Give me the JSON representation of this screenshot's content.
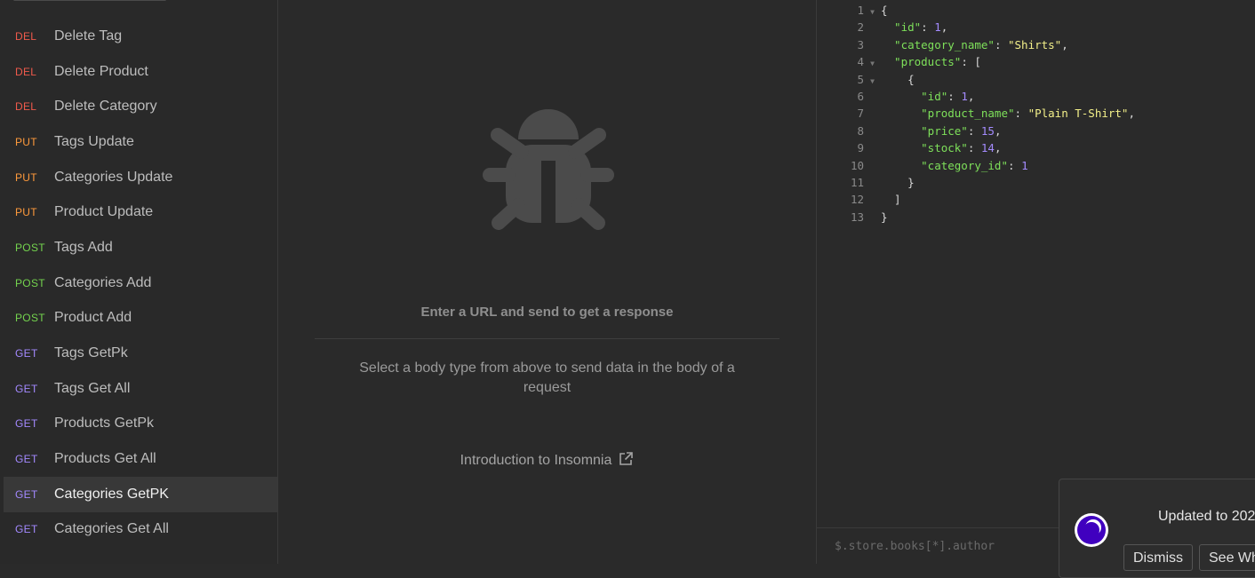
{
  "sidebar": {
    "items": [
      {
        "method": "DEL",
        "label": "Delete Tag"
      },
      {
        "method": "DEL",
        "label": "Delete Product"
      },
      {
        "method": "DEL",
        "label": "Delete Category"
      },
      {
        "method": "PUT",
        "label": "Tags Update"
      },
      {
        "method": "PUT",
        "label": "Categories Update"
      },
      {
        "method": "PUT",
        "label": "Product Update"
      },
      {
        "method": "POST",
        "label": "Tags Add"
      },
      {
        "method": "POST",
        "label": "Categories Add"
      },
      {
        "method": "POST",
        "label": "Product Add"
      },
      {
        "method": "GET",
        "label": "Tags GetPk"
      },
      {
        "method": "GET",
        "label": "Tags Get All"
      },
      {
        "method": "GET",
        "label": "Products GetPk"
      },
      {
        "method": "GET",
        "label": "Products Get All"
      },
      {
        "method": "GET",
        "label": "Categories GetPK",
        "active": true
      },
      {
        "method": "GET",
        "label": "Categories Get All"
      }
    ]
  },
  "request": {
    "empty_title": "Enter a URL and send to get a response",
    "empty_hint": "Select a body type from above to send data in the body of a request",
    "intro_link": "Introduction to Insomnia"
  },
  "response": {
    "lines": [
      [
        [
          "punc",
          "{"
        ]
      ],
      [
        [
          "key",
          "  \"id\""
        ],
        [
          "punc",
          ": "
        ],
        [
          "num",
          "1"
        ],
        [
          "punc",
          ","
        ]
      ],
      [
        [
          "key",
          "  \"category_name\""
        ],
        [
          "punc",
          ": "
        ],
        [
          "str",
          "\"Shirts\""
        ],
        [
          "punc",
          ","
        ]
      ],
      [
        [
          "key",
          "  \"products\""
        ],
        [
          "punc",
          ": ["
        ]
      ],
      [
        [
          "punc",
          "    {"
        ]
      ],
      [
        [
          "key",
          "      \"id\""
        ],
        [
          "punc",
          ": "
        ],
        [
          "num",
          "1"
        ],
        [
          "punc",
          ","
        ]
      ],
      [
        [
          "key",
          "      \"product_name\""
        ],
        [
          "punc",
          ": "
        ],
        [
          "str",
          "\"Plain T-Shirt\""
        ],
        [
          "punc",
          ","
        ]
      ],
      [
        [
          "key",
          "      \"price\""
        ],
        [
          "punc",
          ": "
        ],
        [
          "num",
          "15"
        ],
        [
          "punc",
          ","
        ]
      ],
      [
        [
          "key",
          "      \"stock\""
        ],
        [
          "punc",
          ": "
        ],
        [
          "num",
          "14"
        ],
        [
          "punc",
          ","
        ]
      ],
      [
        [
          "key",
          "      \"category_id\""
        ],
        [
          "punc",
          ": "
        ],
        [
          "num",
          "1"
        ]
      ],
      [
        [
          "punc",
          "    }"
        ]
      ],
      [
        [
          "punc",
          "  ]"
        ]
      ],
      [
        [
          "punc",
          "}"
        ]
      ]
    ],
    "foldable_lines": [
      1,
      4,
      5
    ],
    "filter_placeholder": "$.store.books[*].author"
  },
  "toast": {
    "text": "Updated to 202",
    "dismiss_label": "Dismiss",
    "see_label": "See Wh"
  },
  "colors": {
    "del": "#f05a4c",
    "put": "#ff9a3c",
    "post": "#74d34e",
    "get": "#a389ff",
    "json_key": "#7ee05a",
    "json_string": "#f3f08a",
    "json_number": "#a48bff",
    "brand": "#4000bf"
  }
}
